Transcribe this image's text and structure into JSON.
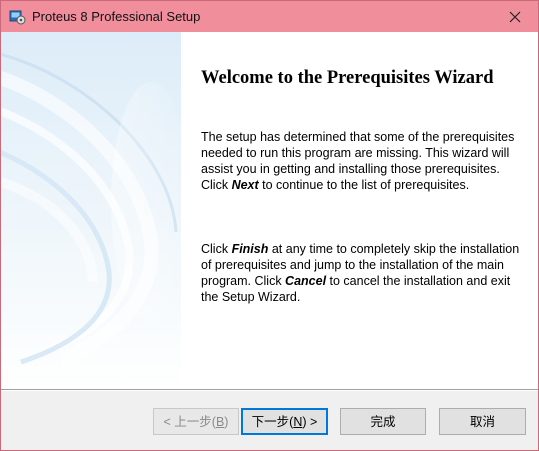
{
  "window": {
    "title": "Proteus 8 Professional Setup"
  },
  "wizard": {
    "heading": "Welcome to the Prerequisites Wizard",
    "para1_before": "The setup has determined that some of the prerequisites needed to run this program are missing. This wizard will assist you in getting and installing those prerequisites. Click ",
    "para1_emph": "Next",
    "para1_after": "  to continue to the list of prerequisites.",
    "para2_before": "Click ",
    "para2_emph1": "Finish",
    "para2_mid": " at any time to completely skip the installation of prerequisites and jump to the installation of the main program. Click ",
    "para2_emph2": "Cancel",
    "para2_after": " to cancel the installation and exit the Setup Wizard."
  },
  "buttons": {
    "back_prefix": "< 上一步(",
    "back_key": "B",
    "back_suffix": ")",
    "next_prefix": "下一步(",
    "next_key": "N",
    "next_suffix": ") >",
    "finish": "完成",
    "cancel": "取消"
  },
  "colors": {
    "titlebar": "#f08e9c",
    "accent": "#0078d7"
  }
}
